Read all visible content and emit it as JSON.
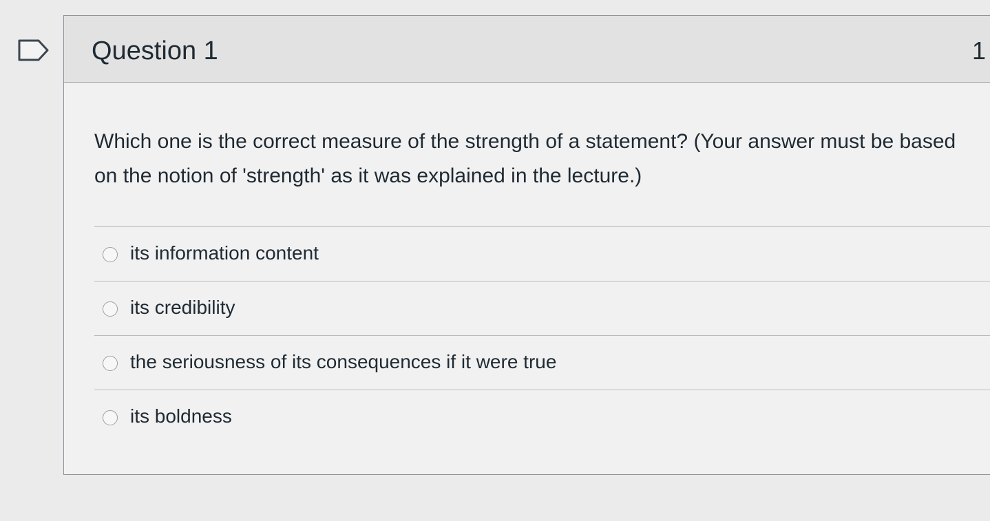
{
  "question": {
    "title": "Question 1",
    "points": "1",
    "text": "Which one is the correct measure of the strength of a statement? (Your answer must be based on the notion of 'strength' as it was explained in the lecture.)",
    "flag_icon": "flag-outline-icon"
  },
  "answers": [
    {
      "label": "its information content",
      "selected": false
    },
    {
      "label": "its credibility",
      "selected": false
    },
    {
      "label": "the seriousness of its consequences if it were true",
      "selected": false
    },
    {
      "label": "its boldness",
      "selected": false
    }
  ],
  "colors": {
    "page_background": "#ebebeb",
    "header_background": "#e2e2e2",
    "text": "#1f2a33",
    "border": "#8f9499"
  }
}
